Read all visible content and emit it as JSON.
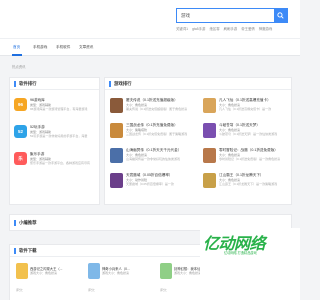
{
  "search": {
    "value": "游戏"
  },
  "hot_tags": [
    "关键词1",
    "gta5手游",
    "绝区零",
    "刷刷手游",
    "帝王爱情",
    "神魔游戏"
  ],
  "nav": [
    {
      "label": "首页",
      "active": true
    },
    {
      "label": "手机游戏",
      "active": false
    },
    {
      "label": "手机软件",
      "active": false
    },
    {
      "label": "文章资讯",
      "active": false
    }
  ],
  "breadcrumb": "热点资讯",
  "software_rank": {
    "title": "软件排行",
    "items": [
      {
        "name": "96游戏库",
        "meta": "类型：游戏辅助",
        "size": "大小：",
        "desc": "96游戏库是一款游戏管理平台，有海量游戏",
        "icon_text": "96",
        "color": "#f6a623"
      },
      {
        "name": "52玩手游",
        "meta": "类型：游戏辅助",
        "size": "大小：",
        "desc": "52玩手游是一款非常好用的手游平台，海量",
        "icon_text": "52",
        "color": "#2ea3e8"
      },
      {
        "name": "聚乐手游",
        "meta": "类型：游戏辅助",
        "size": "大小：",
        "desc": "聚乐手游是一款手游平台，各种游戏应有尽有",
        "icon_text": "乐",
        "color": "#ff5b5b"
      }
    ]
  },
  "game_rank": {
    "title": "游戏排行",
    "col1": [
      {
        "name": "屠夫传说（0.1折送充值超级版）",
        "meta": "大小：角色扮演",
        "desc": "屠夫传说（0.1折送充值超级版）属于角色扮演",
        "color": "#8a5a3a"
      },
      {
        "name": "三国战龙传（0.1折充值免费版）",
        "meta": "大小：策略塔防",
        "desc": "三国战龙传（0.1折充值免费版）属于策略游戏",
        "color": "#c98a3c"
      },
      {
        "name": "山海幽冥传（0.1折天天千元代金）",
        "meta": "大小：角色扮演",
        "desc": "山海幽冥传是一款非常好玩的仙侠类游戏",
        "color": "#4b6fa8"
      },
      {
        "name": "天寰魔域（0.05折百倍爆率）",
        "meta": "大小：动作冒险",
        "desc": "天寰魔域（0.05折百倍爆率）是一款",
        "color": "#6b3f8a"
      }
    ],
    "col2": [
      {
        "name": "凡人飞仙（0.1折送高爆充值卡）",
        "meta": "大小：角色扮演",
        "desc": "凡人飞仙（0.1折送高爆充值卡）是一款",
        "color": "#d9a55a"
      },
      {
        "name": "斗破苍穹（0.1折送天梦）",
        "meta": "大小：角色扮演",
        "desc": "斗破苍穹（0.1折送天梦）是一款仙侠类游戏",
        "color": "#7a4fb0"
      },
      {
        "name": "零时冒险记：战魔（0.1折送免费版）",
        "meta": "大小：角色扮演",
        "desc": "零时冒险记（0.1折送免费版）是一款角色扮演",
        "color": "#b8784a"
      },
      {
        "name": "江山霸王（0.1折龙腾天下）",
        "meta": "大小：角色扮演",
        "desc": "江山霸王（0.1折龙腾天下）是一款策略游戏",
        "color": "#c8a048"
      }
    ]
  },
  "mini_games": {
    "title": "小编推荐"
  },
  "downloads": {
    "title": "软件下载",
    "more": "更多 »",
    "items": [
      {
        "title": "西游记之闪现大王（...",
        "sub": "游戏大小：角色扮演",
        "foot": "评分：",
        "color": "#f2c14e"
      },
      {
        "title": "神奇小兵来人（0...",
        "sub": "游戏大小：角色扮演",
        "foot": "评分：",
        "color": "#7fb8e8"
      },
      {
        "title": "封神幻想：我本仙人",
        "sub": "游戏大小：角色扮演",
        "foot": "评分：",
        "color": "#8fcf86"
      }
    ]
  },
  "brand": {
    "name": "亿动网络",
    "sub": "亿动网络 打造精品游戏"
  }
}
